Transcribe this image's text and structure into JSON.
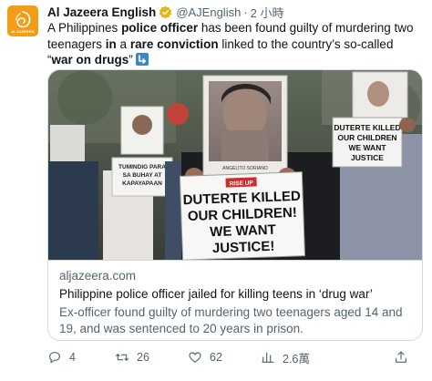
{
  "author": {
    "name": "Al Jazeera English",
    "handle": "@AJEnglish",
    "separator": "·",
    "time": "2 小時",
    "avatar_text": "ALJAZEERA",
    "brand_color": "#f29d18",
    "verified_color": "#e2b719"
  },
  "tweet": {
    "segments": [
      {
        "text": "A Philippines ",
        "bold": false
      },
      {
        "text": "police officer",
        "bold": true
      },
      {
        "text": " has been found guilty of murdering two teenagers ",
        "bold": false
      },
      {
        "text": "in",
        "bold": true
      },
      {
        "text": " a ",
        "bold": false
      },
      {
        "text": "rare conviction",
        "bold": true
      },
      {
        "text": " linked to the country’s so-called “",
        "bold": false
      },
      {
        "text": "war on drugs",
        "bold": true
      },
      {
        "text": "”",
        "bold": false
      }
    ],
    "emoji": "arrow-down-right-icon"
  },
  "card": {
    "image": {
      "main_sign_lines": [
        "DUTERTE KILLED",
        "OUR CHILDREN!",
        "WE WANT",
        "JUSTICE!"
      ],
      "rise_up_label": "RISE UP",
      "right_sign_lines": [
        "DUTERTE KILLED",
        "OUR CHILDREN",
        "WE WANT",
        "JUSTICE"
      ],
      "left_sign_lines": [
        "TUMINDIG PARA",
        "SA BUHAY AT",
        "KAPAYAPAAN"
      ],
      "portrait_caption": "ANGELITO SORIANO"
    },
    "domain": "aljazeera.com",
    "title": "Philippine police officer jailed for killing teens in ‘drug war’",
    "description": "Ex-officer found guilty of murdering two teenagers aged 14 and 19, and was sentenced to 20 years in prison."
  },
  "actions": {
    "replies": "4",
    "retweets": "26",
    "likes": "62",
    "views": "2.6萬",
    "icons": [
      "reply-icon",
      "retweet-icon",
      "like-icon",
      "views-icon",
      "share-icon"
    ]
  },
  "colors": {
    "text": "#0f1419",
    "secondary": "#536471",
    "border": "#cfd9de"
  }
}
